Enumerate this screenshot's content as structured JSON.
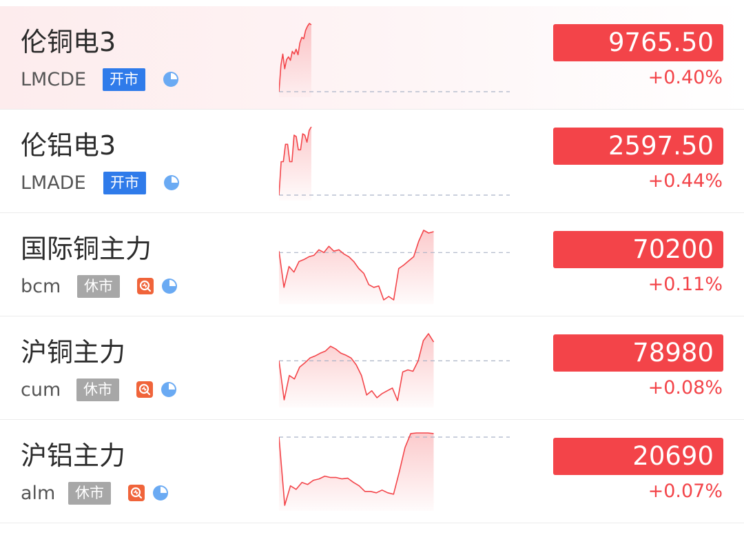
{
  "colors": {
    "up_red": "#f34449",
    "open_badge_blue": "#2f7bea",
    "closed_badge_gray": "#a7a7a7",
    "clock_icon_blue": "#6aaaf3",
    "alert_icon_orange": "#f0643a",
    "row_highlight": "#fdeced"
  },
  "quotes": [
    {
      "name": "伦铜电3",
      "code": "LMCDE",
      "status": "开市",
      "status_kind": "open",
      "price": "9765.50",
      "change": "+0.40%",
      "icons": [
        "pie-clock-icon"
      ],
      "chart_data": {
        "type": "line",
        "y_normalized": [
          0.02,
          0.4,
          0.56,
          0.35,
          0.48,
          0.52,
          0.47,
          0.6,
          0.56,
          0.63,
          0.55,
          0.72,
          0.8,
          0.78,
          0.9,
          0.96,
          1.0,
          0.98
        ],
        "baseline_normalized": 0.02,
        "session_fraction_drawn": 0.14
      }
    },
    {
      "name": "伦铝电3",
      "code": "LMADE",
      "status": "开市",
      "status_kind": "open",
      "price": "2597.50",
      "change": "+0.44%",
      "icons": [
        "pie-clock-icon"
      ],
      "chart_data": {
        "type": "line",
        "y_normalized": [
          0.02,
          0.5,
          0.5,
          0.75,
          0.75,
          0.5,
          0.5,
          0.88,
          0.86,
          0.67,
          0.67,
          0.9,
          0.88,
          0.78,
          0.95,
          1.0
        ],
        "baseline_normalized": 0.02,
        "session_fraction_drawn": 0.14
      }
    },
    {
      "name": "国际铜主力",
      "code": "bcm",
      "status": "休市",
      "status_kind": "closed",
      "price": "70200",
      "change": "+0.11%",
      "icons": [
        "alert-icon",
        "pie-clock-icon"
      ],
      "chart_data": {
        "type": "line",
        "y_normalized": [
          0.7,
          0.18,
          0.48,
          0.4,
          0.55,
          0.58,
          0.62,
          0.64,
          0.72,
          0.68,
          0.77,
          0.7,
          0.72,
          0.66,
          0.62,
          0.55,
          0.45,
          0.38,
          0.22,
          0.18,
          0.2,
          0.0,
          0.05,
          0.0,
          0.45,
          0.5,
          0.56,
          0.62,
          0.84,
          1.0,
          0.96,
          0.98
        ],
        "baseline_normalized": 0.68,
        "session_fraction_drawn": 0.67
      }
    },
    {
      "name": "沪铜主力",
      "code": "cum",
      "status": "休市",
      "status_kind": "closed",
      "price": "78980",
      "change": "+0.08%",
      "icons": [
        "alert-icon",
        "pie-clock-icon"
      ],
      "chart_data": {
        "type": "line",
        "y_normalized": [
          0.61,
          0.05,
          0.4,
          0.35,
          0.52,
          0.58,
          0.65,
          0.68,
          0.72,
          0.75,
          0.82,
          0.78,
          0.72,
          0.69,
          0.65,
          0.55,
          0.4,
          0.12,
          0.18,
          0.08,
          0.14,
          0.18,
          0.22,
          0.04,
          0.45,
          0.48,
          0.46,
          0.61,
          0.9,
          1.0,
          0.88
        ],
        "baseline_normalized": 0.61,
        "session_fraction_drawn": 0.67
      }
    },
    {
      "name": "沪铝主力",
      "code": "alm",
      "status": "休市",
      "status_kind": "closed",
      "price": "20690",
      "change": "+0.07%",
      "icons": [
        "alert-icon",
        "pie-clock-icon"
      ],
      "chart_data": {
        "type": "line",
        "y_normalized": [
          1.0,
          0.02,
          0.3,
          0.25,
          0.35,
          0.32,
          0.38,
          0.4,
          0.44,
          0.42,
          0.42,
          0.4,
          0.41,
          0.35,
          0.3,
          0.22,
          0.22,
          0.2,
          0.24,
          0.2,
          0.18,
          0.5,
          0.85,
          1.05,
          1.1,
          1.2,
          1.15,
          1.05
        ],
        "baseline_normalized": 1.0,
        "session_fraction_drawn": 0.67
      }
    }
  ]
}
